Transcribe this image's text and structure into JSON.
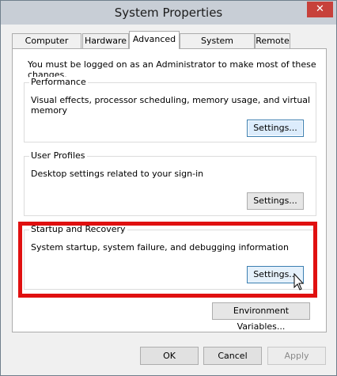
{
  "window": {
    "title": "System Properties",
    "close_label": "✕"
  },
  "tabs": [
    {
      "label": "Computer Name",
      "active": false
    },
    {
      "label": "Hardware",
      "active": false
    },
    {
      "label": "Advanced",
      "active": true
    },
    {
      "label": "System Protection",
      "active": false
    },
    {
      "label": "Remote",
      "active": false
    }
  ],
  "panel": {
    "intro": "You must be logged on as an Administrator to make most of these changes.",
    "performance": {
      "title": "Performance",
      "description": "Visual effects, processor scheduling, memory usage, and virtual memory",
      "button": "Settings..."
    },
    "user_profiles": {
      "title": "User Profiles",
      "description": "Desktop settings related to your sign-in",
      "button": "Settings..."
    },
    "startup_recovery": {
      "title": "Startup and Recovery",
      "description": "System startup, system failure, and debugging information",
      "button": "Settings..."
    },
    "env_button": "Environment Variables..."
  },
  "footer": {
    "ok": "OK",
    "cancel": "Cancel",
    "apply": "Apply"
  },
  "colors": {
    "highlight": "#e01010",
    "title_bar": "#c8ced6",
    "close": "#c7413b"
  }
}
